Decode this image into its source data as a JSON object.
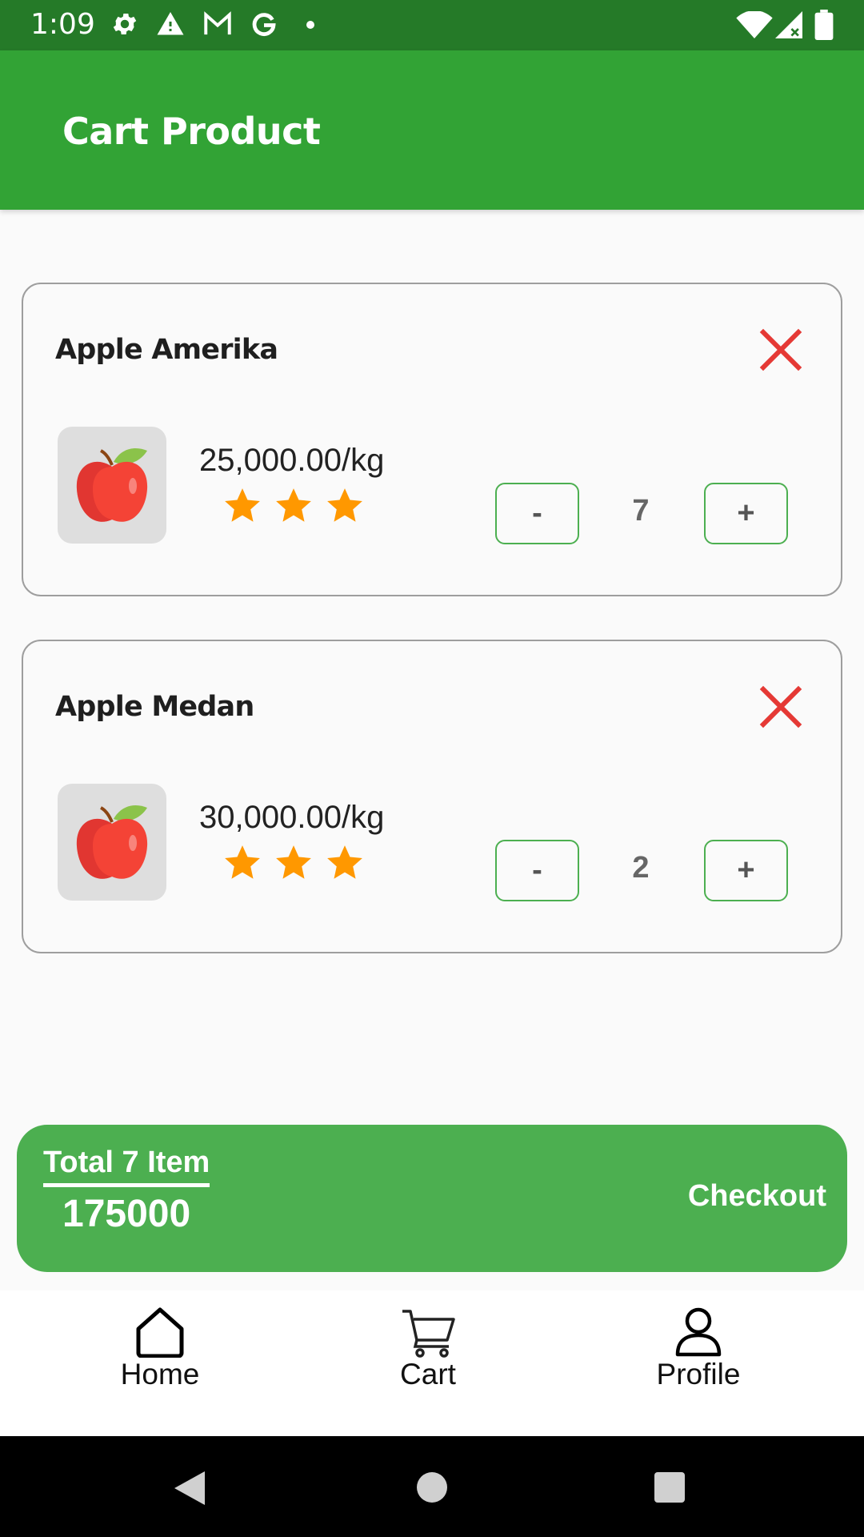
{
  "status_bar": {
    "time": "1:09",
    "left_icons": [
      "settings-icon",
      "alert-icon",
      "gmail-icon",
      "google-icon",
      "dot-icon"
    ],
    "right_icons": [
      "wifi-icon",
      "signal-icon",
      "battery-icon"
    ]
  },
  "app_bar": {
    "title": "Cart Product"
  },
  "cart_items": [
    {
      "name": "Apple Amerika",
      "price": "25,000.00/kg",
      "rating": 3,
      "quantity": "7",
      "minus_label": "-",
      "plus_label": "+"
    },
    {
      "name": "Apple Medan",
      "price": "30,000.00/kg",
      "rating": 3,
      "quantity": "2",
      "minus_label": "-",
      "plus_label": "+"
    }
  ],
  "summary": {
    "total_label": "Total 7 Item",
    "total_value": "175000",
    "checkout_label": "Checkout"
  },
  "bottom_nav": {
    "items": [
      {
        "label": "Home",
        "icon": "home-icon"
      },
      {
        "label": "Cart",
        "icon": "cart-icon"
      },
      {
        "label": "Profile",
        "icon": "profile-icon"
      }
    ]
  },
  "colors": {
    "app_bar": "#32a335",
    "status_bar": "#257a28",
    "accent": "#4caf50",
    "remove": "#e53935",
    "star": "#ff9800"
  }
}
